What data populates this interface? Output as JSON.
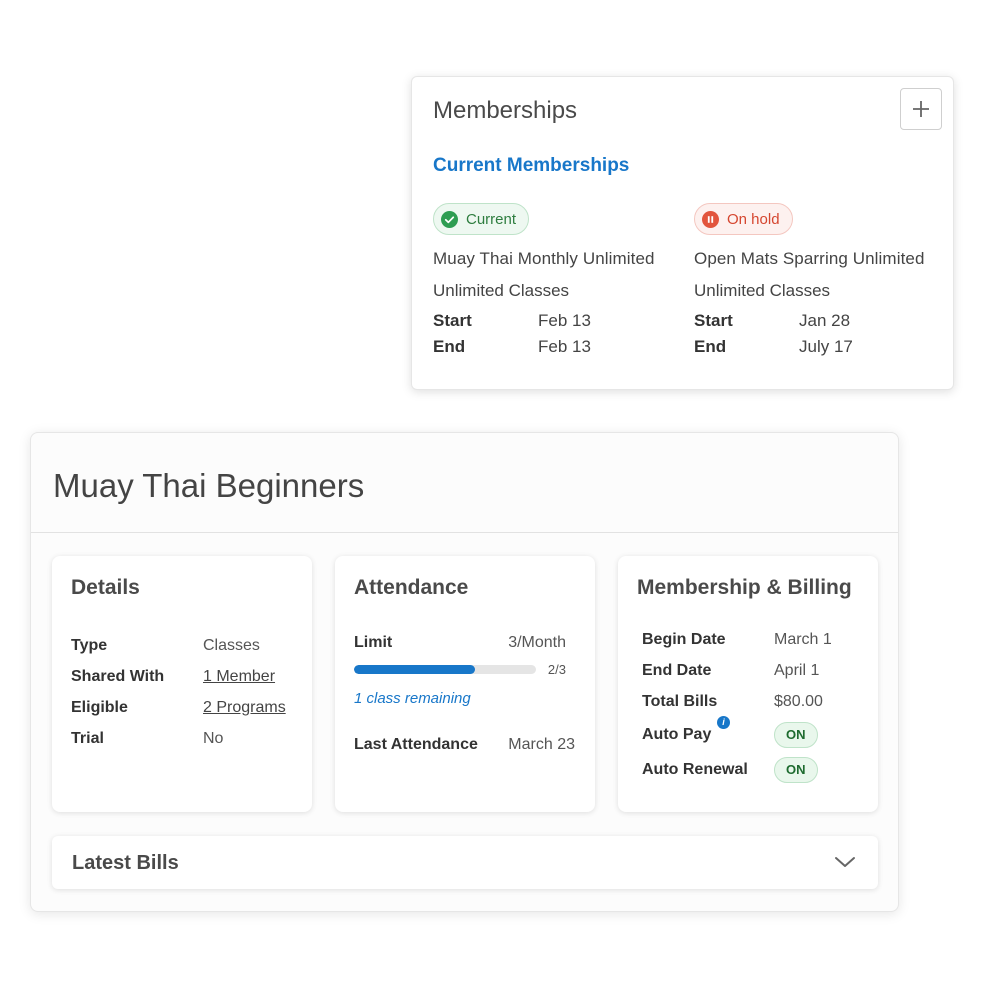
{
  "memberships": {
    "title": "Memberships",
    "subtitle": "Current Memberships",
    "items": [
      {
        "status": "Current",
        "status_color": "#2e9d52",
        "name": "Muay Thai Monthly Unlimited",
        "classes": "Unlimited Classes",
        "start_label": "Start",
        "start": "Feb 13",
        "end_label": "End",
        "end": "Feb 13"
      },
      {
        "status": "On hold",
        "status_color": "#e2553d",
        "name": "Open Mats Sparring Unlimited",
        "classes": "Unlimited Classes",
        "start_label": "Start",
        "start": "Jan 28",
        "end_label": "End",
        "end": "July 17"
      }
    ]
  },
  "program": {
    "title": "Muay Thai Beginners",
    "details": {
      "title": "Details",
      "rows": [
        {
          "label": "Type",
          "value": "Classes"
        },
        {
          "label": "Shared With",
          "value": "1 Member"
        },
        {
          "label": "Eligible",
          "value": "2 Programs"
        },
        {
          "label": "Trial",
          "value": "No"
        }
      ]
    },
    "attendance": {
      "title": "Attendance",
      "limit_label": "Limit",
      "limit_value": "3/Month",
      "progress_count": "2/3",
      "progress_fraction": 0.667,
      "remaining": "1 class remaining",
      "last_label": "Last Attendance",
      "last_value": "March 23"
    },
    "billing": {
      "title": "Membership & Billing",
      "begin_label": "Begin Date",
      "begin_value": "March 1",
      "end_label": "End Date",
      "end_value": "April 1",
      "total_label": "Total Bills",
      "total_value": "$80.00",
      "autopay_label": "Auto Pay",
      "autopay_value": "ON",
      "autorenew_label": "Auto Renewal",
      "autorenew_value": "ON",
      "info_glyph": "i"
    },
    "latest_bills": {
      "title": "Latest Bills"
    }
  },
  "colors": {
    "accent": "#1877c9",
    "on_pill_bg": "#e9f7ec",
    "on_pill_text": "#1e6b2f"
  },
  "icons": {
    "add": "plus-icon",
    "current": "check-circle-icon",
    "hold": "pause-circle-icon",
    "info": "info-icon",
    "expand": "chevron-down-icon"
  }
}
